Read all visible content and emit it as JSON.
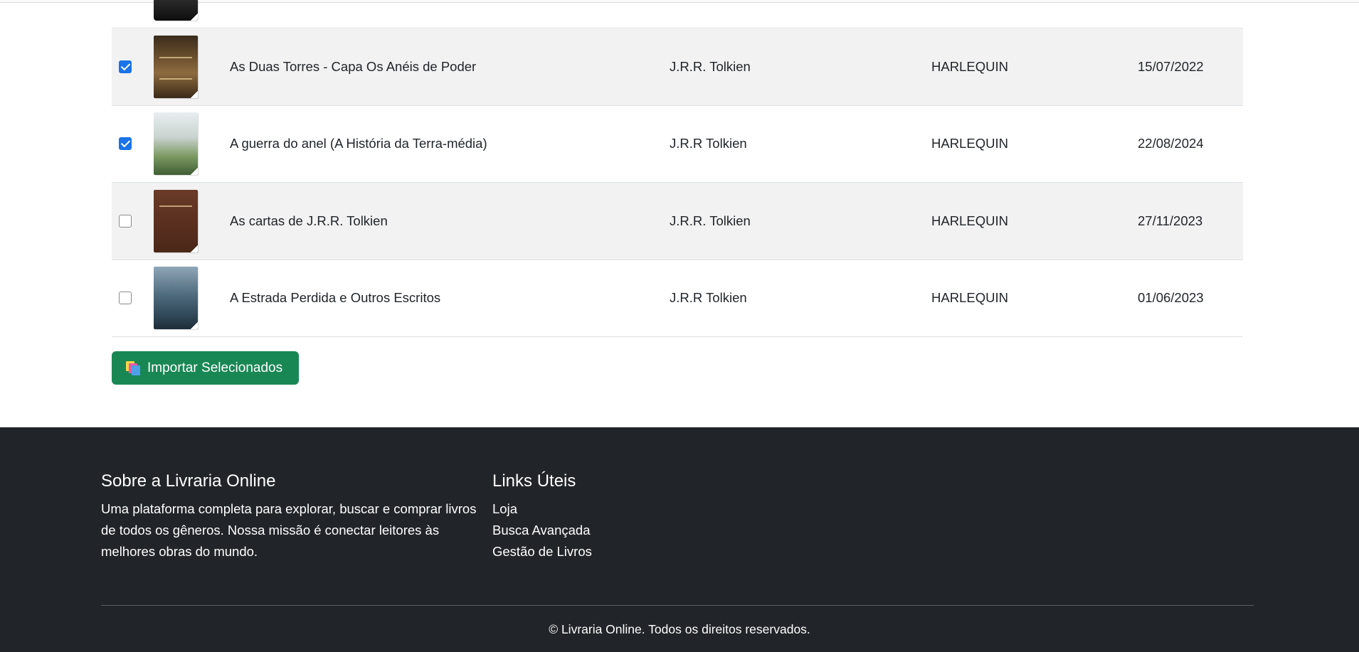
{
  "table": {
    "rows": [
      {
        "checked": true,
        "cover_icon": "book-cover-as-duas-torres",
        "title": "As Duas Torres - Capa Os Anéis de Poder",
        "author": "J.R.R. Tolkien",
        "publisher": "HARLEQUIN",
        "date": "15/07/2022"
      },
      {
        "checked": true,
        "cover_icon": "book-cover-a-guerra-do-anel",
        "title": "A guerra do anel (A História da Terra-média)",
        "author": "J.R.R Tolkien",
        "publisher": "HARLEQUIN",
        "date": "22/08/2024"
      },
      {
        "checked": false,
        "cover_icon": "book-cover-as-cartas",
        "title": "As cartas de J.R.R. Tolkien",
        "author": "J.R.R. Tolkien",
        "publisher": "HARLEQUIN",
        "date": "27/11/2023"
      },
      {
        "checked": false,
        "cover_icon": "book-cover-a-estrada-perdida",
        "title": "A Estrada Perdida e Outros Escritos",
        "author": "J.R.R Tolkien",
        "publisher": "HARLEQUIN",
        "date": "01/06/2023"
      }
    ]
  },
  "actions": {
    "import_label": "Importar Selecionados",
    "import_icon": "books-icon",
    "import_color": "#198754"
  },
  "footer": {
    "about": {
      "heading": "Sobre a Livraria Online",
      "text": "Uma plataforma completa para explorar, buscar e comprar livros de todos os gêneros. Nossa missão é conectar leitores às melhores obras do mundo."
    },
    "links": {
      "heading": "Links Úteis",
      "items": [
        "Loja",
        "Busca Avançada",
        "Gestão de Livros"
      ]
    },
    "copyright": "© Livraria Online. Todos os direitos reservados.",
    "background": "#212529"
  }
}
